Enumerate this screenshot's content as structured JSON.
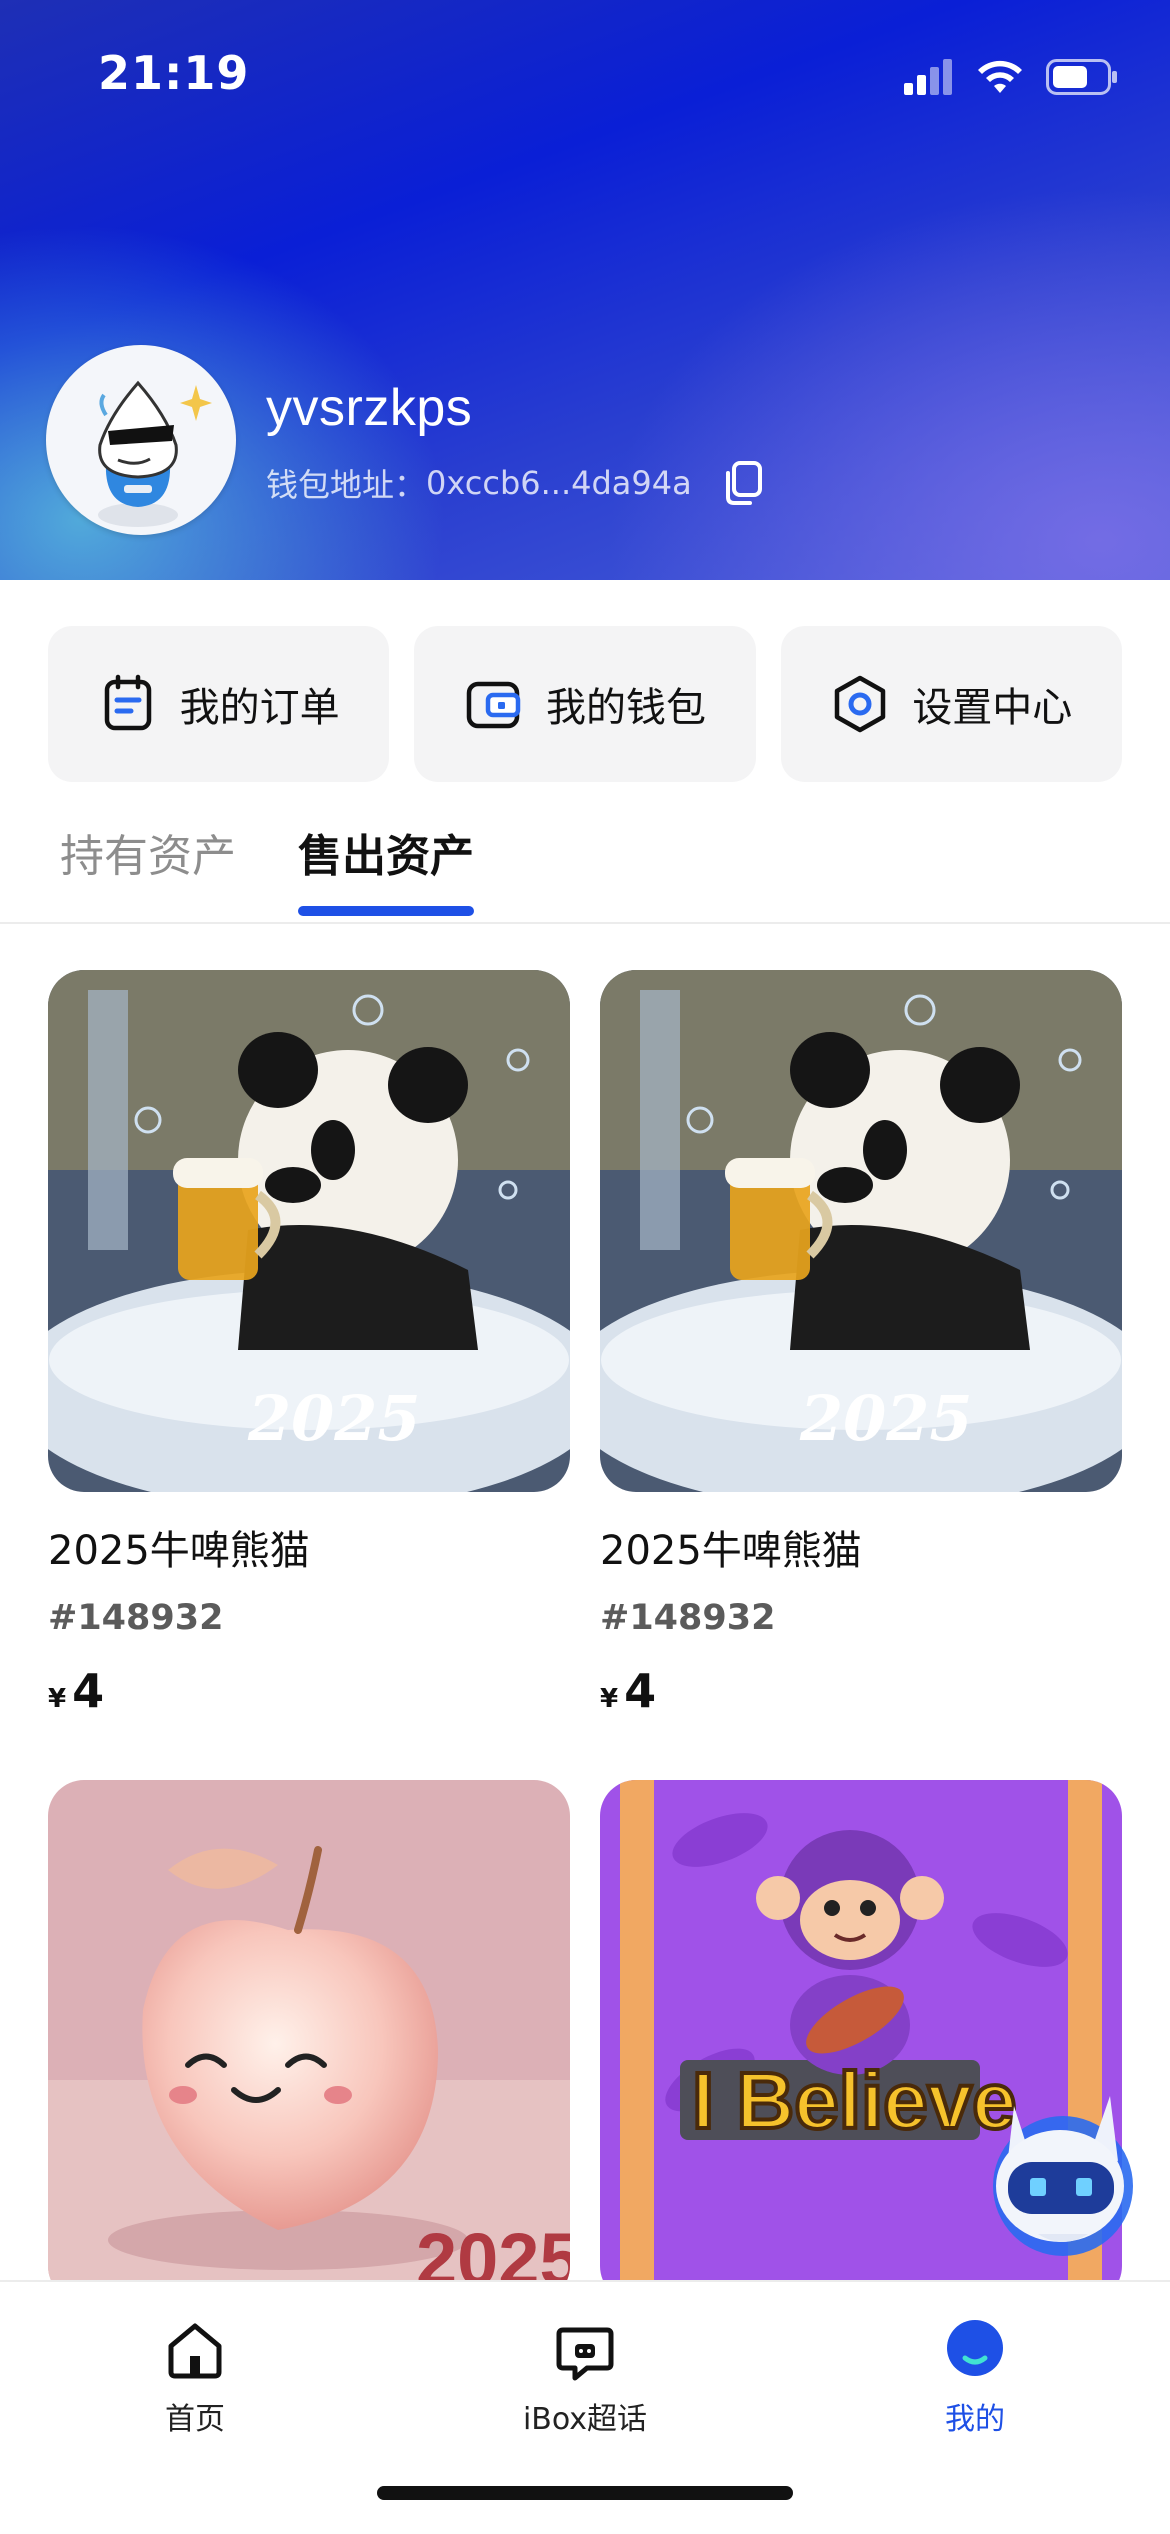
{
  "status_bar": {
    "time": "21:19"
  },
  "profile": {
    "username": "yvsrzkps",
    "wallet_label": "钱包地址：",
    "wallet_address": "0xccb6...4da94a"
  },
  "actions": [
    {
      "label": "我的订单",
      "icon": "order-icon"
    },
    {
      "label": "我的钱包",
      "icon": "wallet-icon"
    },
    {
      "label": "设置中心",
      "icon": "settings-icon"
    }
  ],
  "tabs": [
    {
      "label": "持有资产",
      "active": false
    },
    {
      "label": "售出资产",
      "active": true
    }
  ],
  "items": [
    {
      "name": "2025牛啤熊猫",
      "serial": "#148932",
      "currency": "¥",
      "price": "4",
      "image": "panda-beer-2025",
      "image_text": "2025"
    },
    {
      "name": "2025牛啤熊猫",
      "serial": "#148932",
      "currency": "¥",
      "price": "4",
      "image": "panda-beer-2025",
      "image_text": "2025"
    },
    {
      "name": "",
      "serial": "",
      "currency": "",
      "price": "",
      "image": "peach-2025",
      "image_text": "2025"
    },
    {
      "name": "",
      "serial": "",
      "currency": "",
      "price": "",
      "image": "monkey-i-believe",
      "image_text": "I Believe"
    }
  ],
  "bottom_nav": [
    {
      "label": "首页",
      "icon": "home-icon",
      "active": false
    },
    {
      "label": "iBox超话",
      "icon": "chat-icon",
      "active": false
    },
    {
      "label": "我的",
      "icon": "profile-icon",
      "active": true
    }
  ],
  "colors": {
    "accent": "#1e50e6",
    "header": "#0a1fd6"
  }
}
